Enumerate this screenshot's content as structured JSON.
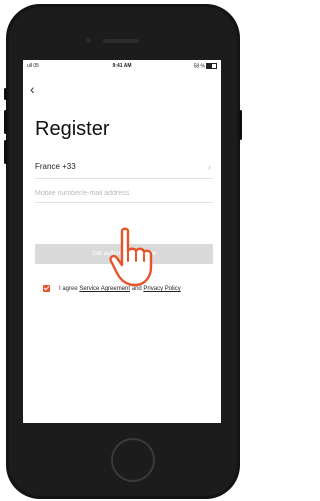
{
  "status_bar": {
    "signal": "ull 05",
    "time": "9:41 AM",
    "battery": "58 %"
  },
  "nav": {
    "back_icon": "chevron-left-icon"
  },
  "page": {
    "title": "Register"
  },
  "country": {
    "label": "France +33"
  },
  "contact_field": {
    "placeholder": "Mobile number/e-mail address",
    "value": ""
  },
  "get_code_button": {
    "label": "Get authentication code"
  },
  "agreement": {
    "checked": true,
    "prefix": "I agree",
    "service_link": "Service Agreement",
    "conjunction": "and",
    "privacy_link": "Privacy Policy"
  },
  "colors": {
    "accent": "#e8542a",
    "button_disabled": "#dadada"
  },
  "overlay": {
    "icon": "pointing-hand-icon"
  }
}
